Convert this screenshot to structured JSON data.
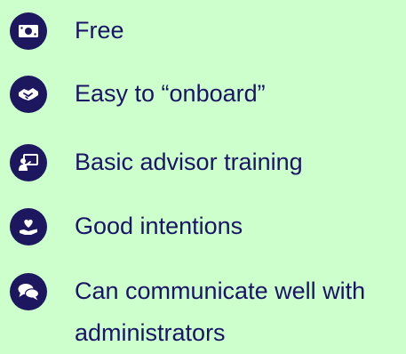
{
  "colors": {
    "background": "#ccffcc",
    "text": "#1a1466",
    "icon_bg": "#1c175e",
    "icon_fg": "#ffffff"
  },
  "items": [
    {
      "icon": "cash-icon",
      "label": "Free"
    },
    {
      "icon": "handshake-icon",
      "label": "Easy to “onboard”"
    },
    {
      "icon": "presentation-icon",
      "label": "Basic advisor training"
    },
    {
      "icon": "hand-heart-icon",
      "label": "Good intentions"
    },
    {
      "icon": "chat-bubbles-icon",
      "label": "Can communicate well with administrators"
    }
  ]
}
